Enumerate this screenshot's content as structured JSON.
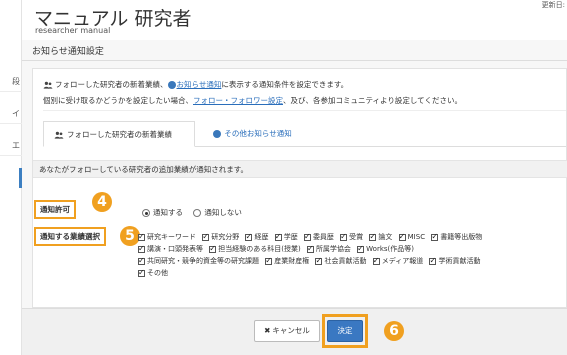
{
  "header": {
    "title": "マニュアル 研究者",
    "subtitle": "researcher manual",
    "right_text": "更新日:"
  },
  "sidebar": {
    "items": [
      {
        "label": "段"
      },
      {
        "label": "イ"
      },
      {
        "label": "エ"
      }
    ]
  },
  "page": {
    "section_title": "お知らせ通知設定"
  },
  "info": {
    "line1_prefix": "フォローした研究者の新着業績、",
    "line1_link": "お知らせ通知",
    "line1_suffix": "に表示する通知条件を設定できます。",
    "line2_prefix": "個別に受け取るかどうかを設定したい場合、",
    "line2_link": "フォロー・フォロワー設定",
    "line2_suffix": "、及び、各参加コミュニティより設定してください。"
  },
  "tabs": [
    {
      "label": "フォローした研究者の新着業績"
    },
    {
      "label": "その他お知らせ通知"
    }
  ],
  "notice": "あなたがフォローしている研究者の追加業績が通知されます。",
  "notify": {
    "label": "通知許可",
    "step": "4",
    "options": [
      {
        "label": "通知する",
        "selected": true
      },
      {
        "label": "通知しない",
        "selected": false
      }
    ]
  },
  "achievements": {
    "label": "通知する業績選択",
    "step": "5",
    "rows": [
      [
        "研究キーワード",
        "研究分野",
        "経歴",
        "学歴",
        "委員歴",
        "受賞",
        "論文",
        "MISC",
        "書籍等出版物"
      ],
      [
        "講演・口頭発表等",
        "担当経験のある科目(授業)",
        "所属学協会",
        "Works(作品等)"
      ],
      [
        "共同研究・競争的資金等の研究課題",
        "産業財産権",
        "社会貢献活動",
        "メディア報道",
        "学術貢献活動"
      ],
      [
        "その他"
      ]
    ]
  },
  "footer": {
    "cancel_label": "キャンセル",
    "submit_label": "決定",
    "step": "6"
  },
  "colors": {
    "accent": "#f0a020",
    "link": "#2a6ebb",
    "primary_button": "#3a78c2"
  }
}
